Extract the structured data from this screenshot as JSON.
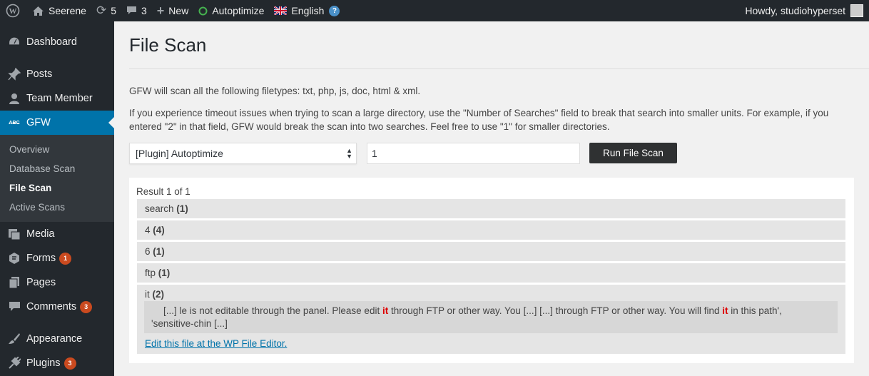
{
  "adminbar": {
    "site_name": "Seerene",
    "updates_count": "5",
    "comments_count": "3",
    "new_label": "New",
    "autoptimize_label": "Autoptimize",
    "language_label": "English",
    "howdy": "Howdy, studiohyperset"
  },
  "sidebar": {
    "items": [
      {
        "label": "Dashboard",
        "icon": "dashboard-icon"
      },
      {
        "label": "Posts",
        "icon": "pin-icon"
      },
      {
        "label": "Team Member",
        "icon": "user-icon"
      },
      {
        "label": "GFW",
        "icon": "abc-icon"
      },
      {
        "label": "Media",
        "icon": "media-icon"
      },
      {
        "label": "Forms",
        "icon": "forms-icon",
        "badge": "1"
      },
      {
        "label": "Pages",
        "icon": "pages-icon"
      },
      {
        "label": "Comments",
        "icon": "comment-icon",
        "badge": "3"
      },
      {
        "label": "Appearance",
        "icon": "brush-icon"
      },
      {
        "label": "Plugins",
        "icon": "plugin-icon",
        "badge": "3"
      }
    ],
    "submenu": [
      "Overview",
      "Database Scan",
      "File Scan",
      "Active Scans"
    ]
  },
  "main": {
    "title": "File Scan",
    "intro": "GFW will scan all the following filetypes: txt, php, js, doc, html & xml.",
    "timeout_line1": "If you experience timeout issues when trying to scan a large directory, use the \"Number of Searches\" field to break that search into smaller units. For example, if you",
    "timeout_line2": "entered \"2\" in that field, GFW would break the scan into two searches. Feel free to use \"1\" for smaller directories.",
    "select_value": "[Plugin] Autoptimize",
    "num_searches_value": "1",
    "run_button": "Run File Scan",
    "result_count": "Result 1 of 1",
    "rows": [
      {
        "term": "search",
        "count": "(1)"
      },
      {
        "term": "4",
        "count": "(4)"
      },
      {
        "term": "6",
        "count": "(1)"
      },
      {
        "term": "ftp",
        "count": "(1)"
      }
    ],
    "it_row": {
      "term": "it",
      "count": "(2)"
    },
    "snippet": {
      "part1": "[...] le is not editable through the panel. Please edit ",
      "hl1": "it",
      "part2": " through FTP or other way. You [...] [...] through FTP or other way. You will find ",
      "hl2": "it",
      "part3": " in this path',",
      "line2": "'sensitive-chin [...]"
    },
    "edit_link": "Edit this file at the WP File Editor."
  }
}
